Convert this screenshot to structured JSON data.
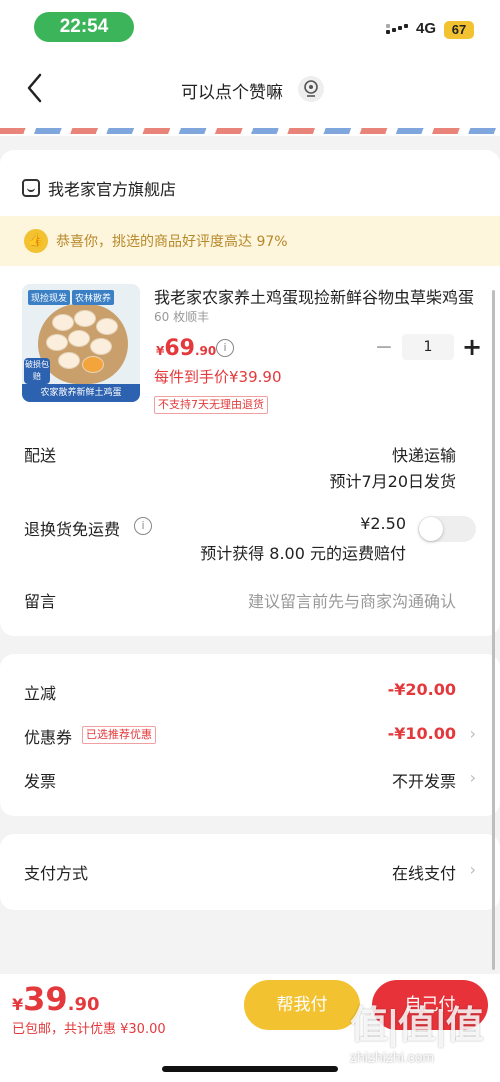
{
  "status": {
    "time": "22:54",
    "network": "4G",
    "battery": "67"
  },
  "nav": {
    "title": "可以点个赞嘛",
    "icon": "location-pin-icon"
  },
  "shop": {
    "name": "我老家官方旗舰店"
  },
  "praise": {
    "text": "恭喜你，挑选的商品好评度高达 97%"
  },
  "product": {
    "image_tags": [
      "现捡现发",
      "农林散养"
    ],
    "image_badge": "破损包赔",
    "image_caption": "农家散养新鲜土鸡蛋",
    "title": "我老家农家养土鸡蛋现捡新鲜谷物虫草柴鸡蛋",
    "spec": "60 枚顺丰",
    "price_currency": "¥",
    "price_int": "69",
    "price_dec": ".90",
    "quantity": "1",
    "deal_price": "每件到手价¥39.90",
    "no_refund": "不支持7天无理由退货"
  },
  "delivery": {
    "label": "配送",
    "method": "快递运输",
    "eta": "预计7月20日发货"
  },
  "freight": {
    "label": "退换货免运费",
    "price": "¥2.50",
    "note": "预计获得 8.00 元的运费赔付",
    "enabled": false
  },
  "message": {
    "label": "留言",
    "placeholder": "建议留言前先与商家沟通确认"
  },
  "discounts": {
    "instant_label": "立减",
    "instant_value": "-¥20.00",
    "coupon_label": "优惠券",
    "coupon_tag": "已选推荐优惠",
    "coupon_value": "-¥10.00",
    "invoice_label": "发票",
    "invoice_value": "不开发票"
  },
  "payment": {
    "label": "支付方式",
    "value": "在线支付"
  },
  "bottom": {
    "total_currency": "¥",
    "total_int": "39",
    "total_dec": ".90",
    "note": "已包邮，共计优惠 ¥30.00",
    "help_pay": "帮我付",
    "self_pay": "自己付"
  },
  "watermark": {
    "logo": "值|值|值",
    "url": "zhizhizhi.com"
  },
  "colors": {
    "accent_red": "#e4393c",
    "yellow": "#f2c230",
    "green_time": "#3cb55a"
  }
}
